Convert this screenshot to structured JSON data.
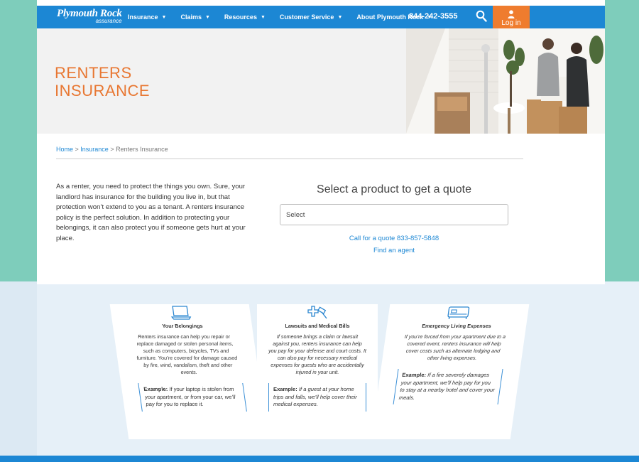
{
  "brand": {
    "name": "Plymouth Rock",
    "sub": "assurance"
  },
  "nav": {
    "items": [
      {
        "label": "Insurance"
      },
      {
        "label": "Claims"
      },
      {
        "label": "Resources"
      },
      {
        "label": "Customer Service"
      },
      {
        "label": "About Plymouth Rock"
      }
    ],
    "phone": "844-242-3555",
    "login_label": "Log in"
  },
  "hero": {
    "title_line1": "RENTERS",
    "title_line2": "INSURANCE"
  },
  "breadcrumb": {
    "home": "Home",
    "sep1": " > ",
    "insurance": "Insurance",
    "sep2": " > ",
    "current": "Renters Insurance"
  },
  "intro": "As a renter, you need to protect the things you own. Sure, your landlord has insurance for the building you live in, but that protection won’t extend to you as a tenant. A renters insurance policy is the perfect solution. In addition to protecting your belongings, it can also protect you if someone gets hurt at your place.",
  "quote": {
    "title": "Select a product to get a quote",
    "select_value": "Select",
    "call_text": "Call for a quote 833-857-5848",
    "agent_text": "Find an agent"
  },
  "cards": [
    {
      "title": "Your Belongings",
      "body": "Renters insurance can help you repair or replace damaged or stolen personal items, such as computers, bicycles, TVs and furniture. You’re covered for damage caused by fire, wind, vandalism, theft and other events.",
      "example_label": "Example:",
      "example_text": " If your laptop is stolen from your apartment, or from your car, we’ll pay for you to replace it."
    },
    {
      "title": "Lawsuits and Medical Bills",
      "body": "If someone brings a claim or lawsuit against you, renters insurance can help you pay for your defense and court costs. It can also pay for necessary medical expenses for guests who are accidentally injured in your unit.",
      "example_label": "Example:",
      "example_text": " If a guest at your home trips and falls, we’ll help cover their medical expenses."
    },
    {
      "title": "Emergency Living Expenses",
      "body": "If you’re forced from your apartment due to a covered event, renters insurance will help cover costs such as alternate lodging and other living expenses.",
      "example_label": "Example:",
      "example_text": " If a fire severely damages your apartment, we’ll help pay for you to stay at a nearby hotel and cover your meals."
    }
  ],
  "colors": {
    "brand_blue": "#1c87d4",
    "accent_orange": "#ef7c2e",
    "frame_teal": "#7ecdbb"
  }
}
